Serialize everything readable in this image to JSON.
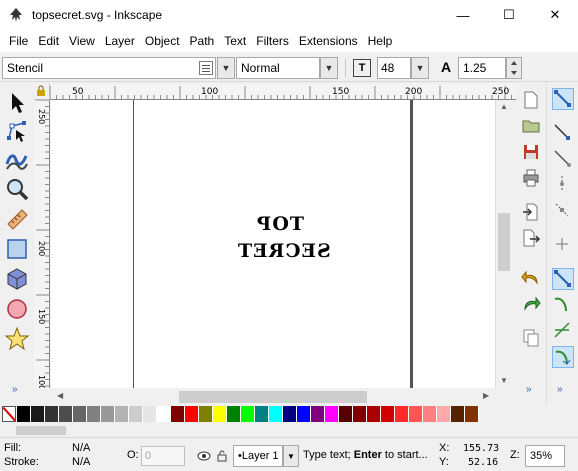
{
  "window": {
    "title": "topsecret.svg - Inkscape",
    "icon": "inkscape-icon",
    "minimize_glyph": "—",
    "maximize_glyph": "☐",
    "close_glyph": "✕"
  },
  "menu": {
    "items": [
      "File",
      "Edit",
      "View",
      "Layer",
      "Object",
      "Path",
      "Text",
      "Filters",
      "Extensions",
      "Help"
    ]
  },
  "text_toolbar": {
    "font_family": "Stencil",
    "font_style": "Normal",
    "font_size": "48",
    "line_spacing": "1.25"
  },
  "rulers": {
    "horizontal_ticks": [
      "50",
      "100",
      "150",
      "200",
      "250"
    ],
    "vertical_ticks": [
      "250",
      "200",
      "150",
      "100"
    ]
  },
  "canvas": {
    "text_line1": "TOP",
    "text_line2": "SECRET"
  },
  "tools": [
    {
      "name": "selector-tool-icon",
      "active": false
    },
    {
      "name": "node-tool-icon",
      "active": false
    },
    {
      "name": "tweak-tool-icon",
      "active": false
    },
    {
      "name": "zoom-tool-icon",
      "active": false
    },
    {
      "name": "measure-tool-icon",
      "active": false
    },
    {
      "name": "rectangle-tool-icon",
      "active": false
    },
    {
      "name": "3d-box-tool-icon",
      "active": false
    },
    {
      "name": "ellipse-tool-icon",
      "active": false
    },
    {
      "name": "star-tool-icon",
      "active": false
    }
  ],
  "more_glyph": "»",
  "palette": {
    "colors": [
      "#000000",
      "#1a1a1a",
      "#333333",
      "#4d4d4d",
      "#666666",
      "#808080",
      "#999999",
      "#b3b3b3",
      "#cccccc",
      "#e6e6e6",
      "#ffffff",
      "#800000",
      "#ff0000",
      "#808000",
      "#ffff00",
      "#008000",
      "#00ff00",
      "#008080",
      "#00ffff",
      "#000080",
      "#0000ff",
      "#800080",
      "#ff00ff",
      "#550000",
      "#800000",
      "#aa0000",
      "#d40000",
      "#ff2a2a",
      "#ff5555",
      "#ff8080",
      "#ffaaaa",
      "#552200",
      "#803300"
    ]
  },
  "status": {
    "fill_label": "Fill:",
    "fill_value": "N/A",
    "stroke_label": "Stroke:",
    "stroke_value": "N/A",
    "opacity_label": "O:",
    "opacity_value": "0",
    "layer_name": "•Layer 1",
    "message_prefix": "Type text; ",
    "message_bold": "Enter",
    "message_suffix": " to start...",
    "x_label": "X:",
    "x_value": "155.73",
    "y_label": "Y:",
    "y_value": "52.16",
    "zoom_label": "Z:",
    "zoom_value": "35%"
  }
}
